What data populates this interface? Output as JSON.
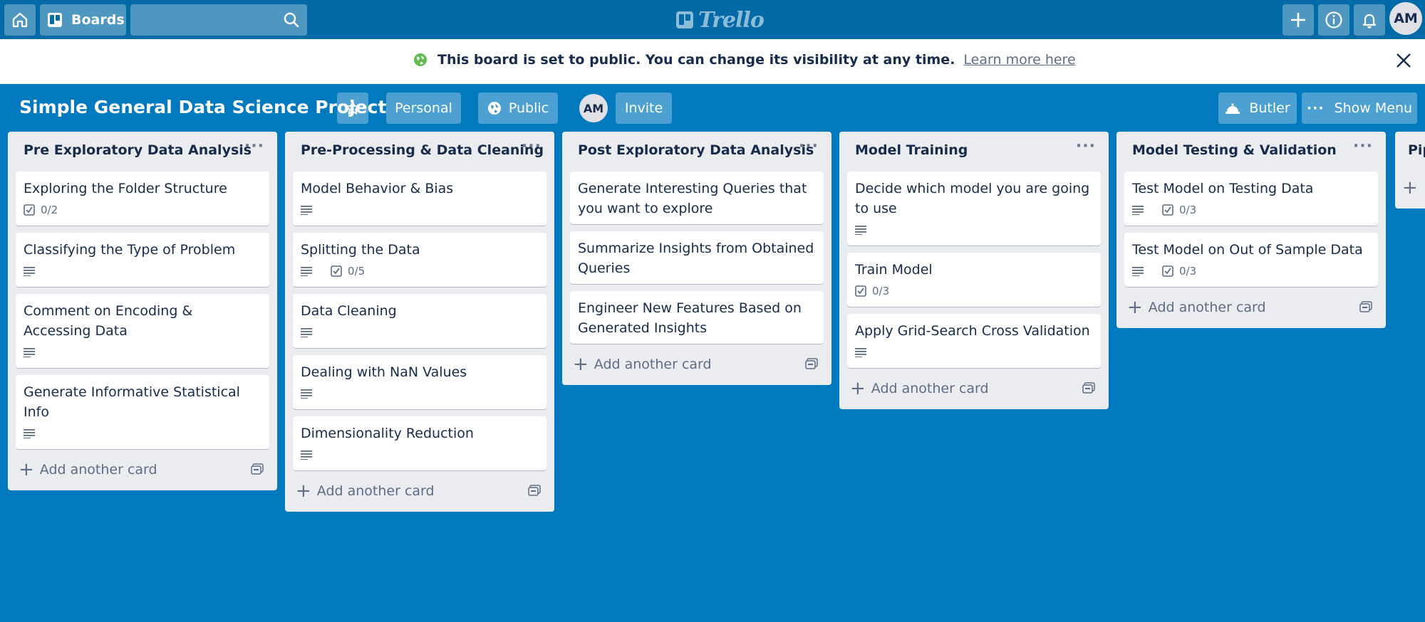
{
  "nav": {
    "boards_label": "Boards",
    "search_value": "",
    "logo_text": "Trello",
    "avatar_initials": "AM"
  },
  "banner": {
    "message": "This board is set to public. You can change its visibility at any time.",
    "link": "Learn more here"
  },
  "board": {
    "title": "Simple General Data Science Project",
    "personal_label": "Personal",
    "visibility_label": "Public",
    "member_initials": "AM",
    "invite_label": "Invite",
    "butler_label": "Butler",
    "show_menu_label": "Show Menu"
  },
  "add_card_label": "Add another card",
  "lists": [
    {
      "title": "Pre Exploratory Data Analysis",
      "cards": [
        {
          "title": "Exploring the Folder Structure",
          "description": false,
          "checklist": "0/2"
        },
        {
          "title": "Classifying the Type of Problem",
          "description": true,
          "checklist": ""
        },
        {
          "title": "Comment on Encoding & Accessing Data",
          "description": true,
          "checklist": ""
        },
        {
          "title": "Generate Informative Statistical Info",
          "description": true,
          "checklist": ""
        }
      ]
    },
    {
      "title": "Pre-Processing & Data Cleaning",
      "cards": [
        {
          "title": "Model Behavior & Bias",
          "description": true,
          "checklist": ""
        },
        {
          "title": "Splitting the Data",
          "description": true,
          "checklist": "0/5"
        },
        {
          "title": "Data Cleaning",
          "description": true,
          "checklist": ""
        },
        {
          "title": "Dealing with NaN Values",
          "description": true,
          "checklist": ""
        },
        {
          "title": "Dimensionality Reduction",
          "description": true,
          "checklist": ""
        }
      ]
    },
    {
      "title": "Post Exploratory Data Analysis",
      "cards": [
        {
          "title": "Generate Interesting Queries that you want to explore",
          "description": false,
          "checklist": ""
        },
        {
          "title": "Summarize Insights from Obtained Queries",
          "description": false,
          "checklist": ""
        },
        {
          "title": "Engineer New Features Based on Generated Insights",
          "description": false,
          "checklist": ""
        }
      ]
    },
    {
      "title": "Model Training",
      "cards": [
        {
          "title": "Decide which model you are going to use",
          "description": true,
          "checklist": ""
        },
        {
          "title": "Train Model",
          "description": false,
          "checklist": "0/3"
        },
        {
          "title": "Apply Grid-Search Cross Validation",
          "description": true,
          "checklist": ""
        }
      ]
    },
    {
      "title": "Model Testing & Validation",
      "cards": [
        {
          "title": "Test Model on Testing Data",
          "description": true,
          "checklist": "0/3"
        },
        {
          "title": "Test Model on Out of Sample Data",
          "description": true,
          "checklist": "0/3"
        }
      ]
    }
  ],
  "partial_list": {
    "title": "Pip"
  },
  "colors": {
    "board_background": "#0079bf",
    "nav_background": "#026aa7",
    "list_background": "#ebecf0",
    "public_globe": "#61bd4f"
  }
}
